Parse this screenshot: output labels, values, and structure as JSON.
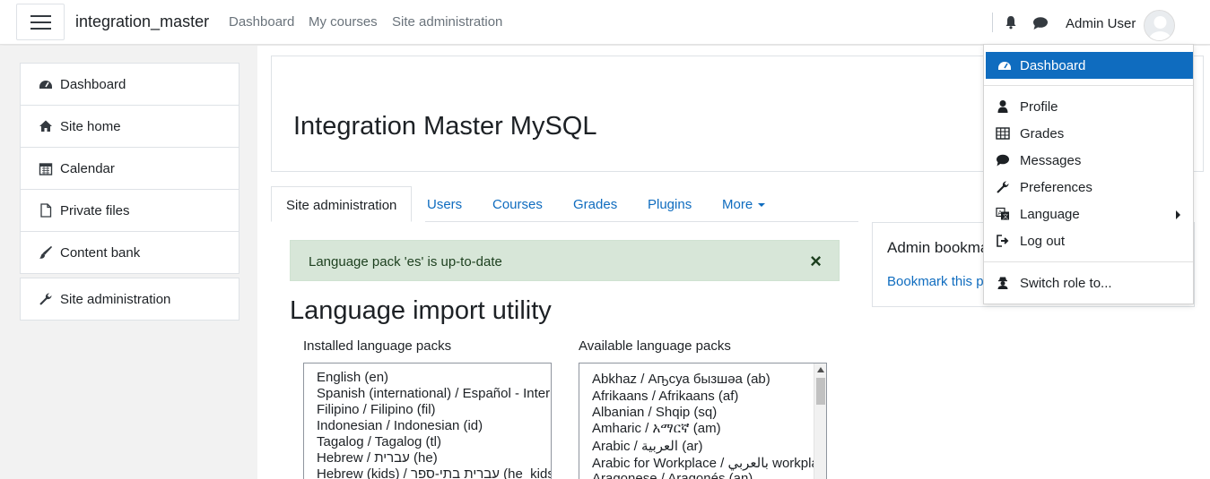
{
  "navbar": {
    "brand": "integration_master",
    "links": [
      "Dashboard",
      "My courses",
      "Site administration"
    ],
    "user_name": "Admin User",
    "icons": [
      "menu-icon",
      "bell-icon",
      "chat-icon",
      "avatar-icon"
    ]
  },
  "drawer": {
    "items": [
      {
        "label": "Dashboard",
        "icon": "dashboard-icon"
      },
      {
        "label": "Site home",
        "icon": "home-icon"
      },
      {
        "label": "Calendar",
        "icon": "calendar-icon"
      },
      {
        "label": "Private files",
        "icon": "file-icon"
      },
      {
        "label": "Content bank",
        "icon": "brush-icon"
      }
    ],
    "admin_item": {
      "label": "Site administration",
      "icon": "wrench-icon"
    }
  },
  "header": {
    "title": "Integration Master MySQL"
  },
  "tabs": {
    "items": [
      "Site administration",
      "Users",
      "Courses",
      "Grades",
      "Plugins",
      "More"
    ],
    "active": "Site administration"
  },
  "alert": {
    "text": "Language pack 'es' is up-to-date",
    "close": "×"
  },
  "page": {
    "heading": "Language import utility",
    "installed_label": "Installed language packs",
    "available_label": "Available language packs",
    "installed": [
      "English (en)",
      "Spanish (international) / Español - Internacional (es)",
      "Filipino / Filipino (fil)",
      "Indonesian / Indonesian (id)",
      "Tagalog / Tagalog (tl)",
      "Hebrew / עברית (he)",
      "Hebrew (kids) / עברית בתי-ספר (he_kids)"
    ],
    "available": [
      "Abkhaz / Аҧсуа бызшәа (ab)",
      "Afrikaans / Afrikaans (af)",
      "Albanian / Shqip (sq)",
      "Amharic / አማርኛ (am)",
      "Arabic / العربية (ar)",
      "Arabic for Workplace / بالعربي workplace (ar_wp)",
      "Aragonese / Aragonés (an)"
    ]
  },
  "bookmarks": {
    "title": "Admin bookmarks",
    "link": "Bookmark this page"
  },
  "user_menu": {
    "items": [
      {
        "label": "Dashboard",
        "icon": "dashboard-icon"
      },
      {
        "label": "Profile",
        "icon": "user-icon"
      },
      {
        "label": "Grades",
        "icon": "table-icon"
      },
      {
        "label": "Messages",
        "icon": "chat-icon"
      },
      {
        "label": "Preferences",
        "icon": "wrench-icon"
      },
      {
        "label": "Language",
        "icon": "language-icon"
      },
      {
        "label": "Log out",
        "icon": "logout-icon"
      },
      {
        "label": "Switch role to...",
        "icon": "switch-role-icon"
      }
    ]
  },
  "colors": {
    "accent": "#0f6cbf",
    "alert_bg": "#d7e6d8",
    "text": "#1d2125"
  }
}
